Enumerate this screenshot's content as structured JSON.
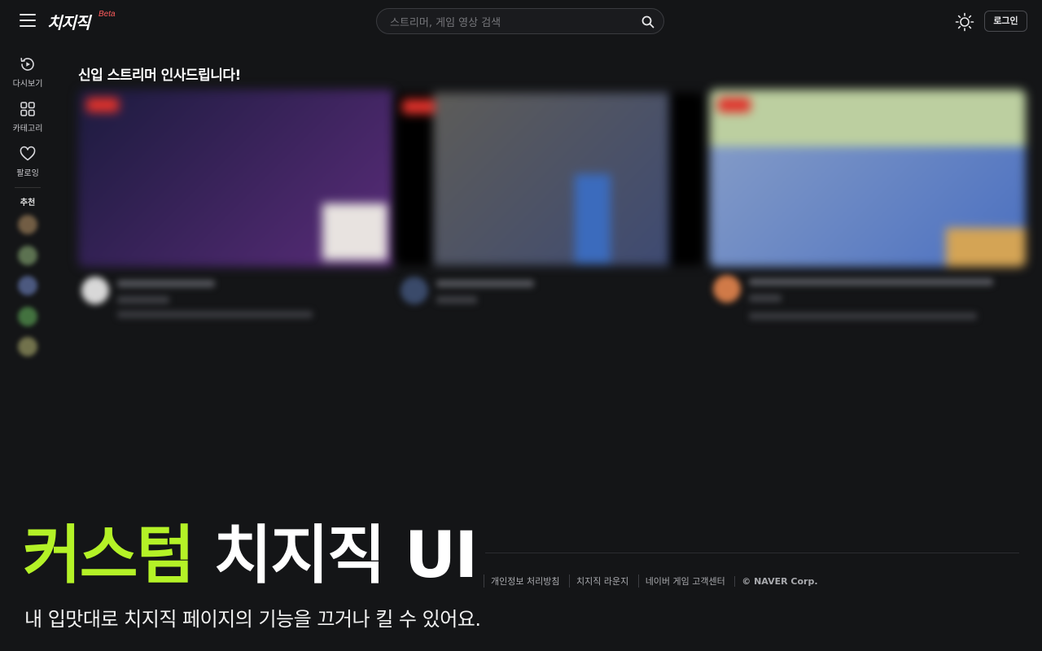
{
  "header": {
    "logo": "치지직",
    "beta": "Beta",
    "search_placeholder": "스트리머, 게임 영상 검색",
    "login": "로그인"
  },
  "sidebar": {
    "items": [
      {
        "label": "다시보기",
        "icon": "replay-icon"
      },
      {
        "label": "카테고리",
        "icon": "grid-icon"
      },
      {
        "label": "팔로잉",
        "icon": "heart-icon"
      }
    ],
    "recommended_label": "추천",
    "recommended_colors": [
      "#8a7050",
      "#6f8a60",
      "#5a6a9a",
      "#4f8a4a",
      "#8a8a5a"
    ]
  },
  "main": {
    "section_title": "신입 스트리머 인사드립니다!",
    "cards": [
      {
        "thumb_color_a": "#1c1b3e",
        "thumb_color_b": "#5a2c7a",
        "badge_color": "#e0322b"
      },
      {
        "thumb_color_a": "#5d5c58",
        "thumb_color_b": "#3e4a72",
        "badge_color": "#e0322b"
      },
      {
        "thumb_color_a": "#8aa0c8",
        "thumb_color_b": "#4a6fc0",
        "badge_color": "#e0322b"
      }
    ]
  },
  "footer": {
    "links": [
      "개인정보 처리방침",
      "치지직 라운지",
      "네이버 게임 고객센터",
      "© NAVER Corp."
    ]
  },
  "caption": {
    "accent": "커스텀",
    "rest": " 치지직 UI",
    "subtitle": "내 입맛대로 치지직 페이지의 기능을 끄거나 킬 수 있어요."
  }
}
